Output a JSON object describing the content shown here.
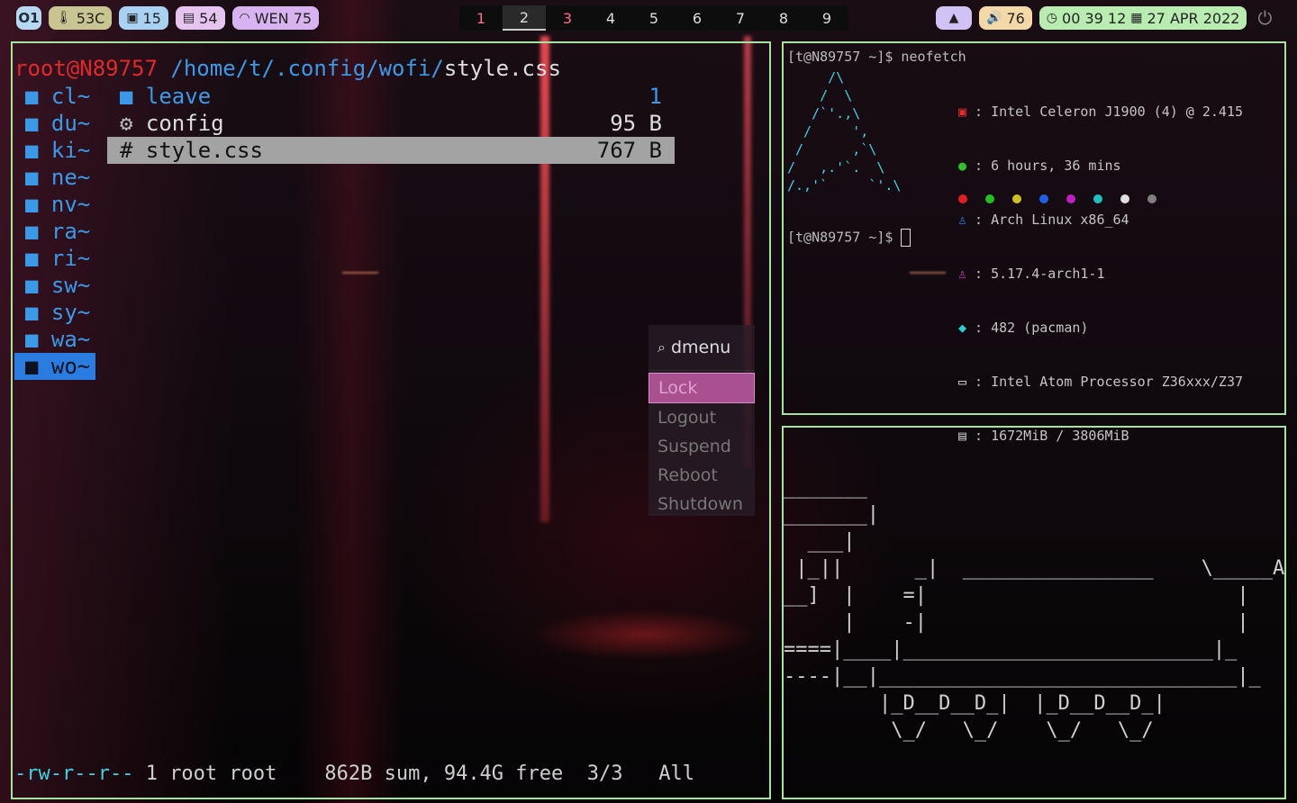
{
  "colors": {
    "border": "#a7e3a0",
    "dir": "#3a9ae8",
    "selected_dir": "#2a7ce0",
    "urgent_workspace": "#ff6b8a"
  },
  "topbar": {
    "logo": "O1",
    "temp": "53C",
    "cpu": "15",
    "ram": "54",
    "wifi": "WEN 75",
    "workspaces": [
      "1",
      "2",
      "3",
      "4",
      "5",
      "6",
      "7",
      "8",
      "9"
    ],
    "volume": "76",
    "time": "00 39 12",
    "date": "27 APR 2022"
  },
  "ranger": {
    "prompt_user": "root@N89757",
    "prompt_path": "/home/t/.config/wofi/",
    "prompt_file": "style.css",
    "dirs": [
      "cl~",
      "du~",
      "ki~",
      "ne~",
      "nv~",
      "ra~",
      "ri~",
      "sw~",
      "sy~",
      "wa~",
      "wo~"
    ],
    "files": [
      {
        "icon": "■",
        "name": "leave",
        "size": "1"
      },
      {
        "icon": "⚙",
        "name": "config",
        "size": "95 B"
      },
      {
        "icon": "#",
        "name": "style.css",
        "size": "767 B"
      }
    ],
    "status_perm": "-rw-r--r--",
    "status_rest": " 1 root root    862B sum, 94.4G free  3/3   All"
  },
  "neofetch": {
    "command_prompt": "[t@N89757 ~]$ neofetch",
    "next_prompt": "[t@N89757 ~]$",
    "art": "     /\\\n    /  \\\n   /`'.,\\\n  /     ',\n /      ,`\\\n/   ,.'`.  \\\n/.,'`     `'.\\",
    "info": [
      {
        "icon": "▣",
        "color": "#e03030",
        "value": "Intel Celeron J1900 (4) @ 2.415"
      },
      {
        "icon": "●",
        "color": "#30c030",
        "value": "6 hours, 36 mins"
      },
      {
        "icon": "♙",
        "color": "#2a7ce0",
        "value": "Arch Linux x86_64"
      },
      {
        "icon": "♙",
        "color": "#c030c0",
        "value": "5.17.4-arch1-1"
      },
      {
        "icon": "◆",
        "color": "#2ad0d0",
        "value": "482 (pacman)"
      },
      {
        "icon": "▭",
        "color": "#dddddd",
        "value": "Intel Atom Processor Z36xxx/Z37"
      },
      {
        "icon": "▤",
        "color": "#bbbbbb",
        "value": "1672MiB / 3806MiB"
      }
    ],
    "palette": [
      "#e02020",
      "#20c020",
      "#d0c020",
      "#2060e0",
      "#c020c0",
      "#20c0c0",
      "#e0e0e0",
      "#808080"
    ]
  },
  "train": {
    "art": "_______\n_______|\n  ___|\n |_||      _|  ________________    \\_____A\n__]  |    =|                          |\n     |    -|                          |\n====|____|__________________________|_\n----|__|______________________________|_\n        |_D__D__D_|  |_D__D__D_|\n         \\_/   \\_/    \\_/   \\_/"
  },
  "dmenu": {
    "search": "dmenu",
    "items": [
      "Lock",
      "Logout",
      "Suspend",
      "Reboot",
      "Shutdown"
    ]
  }
}
